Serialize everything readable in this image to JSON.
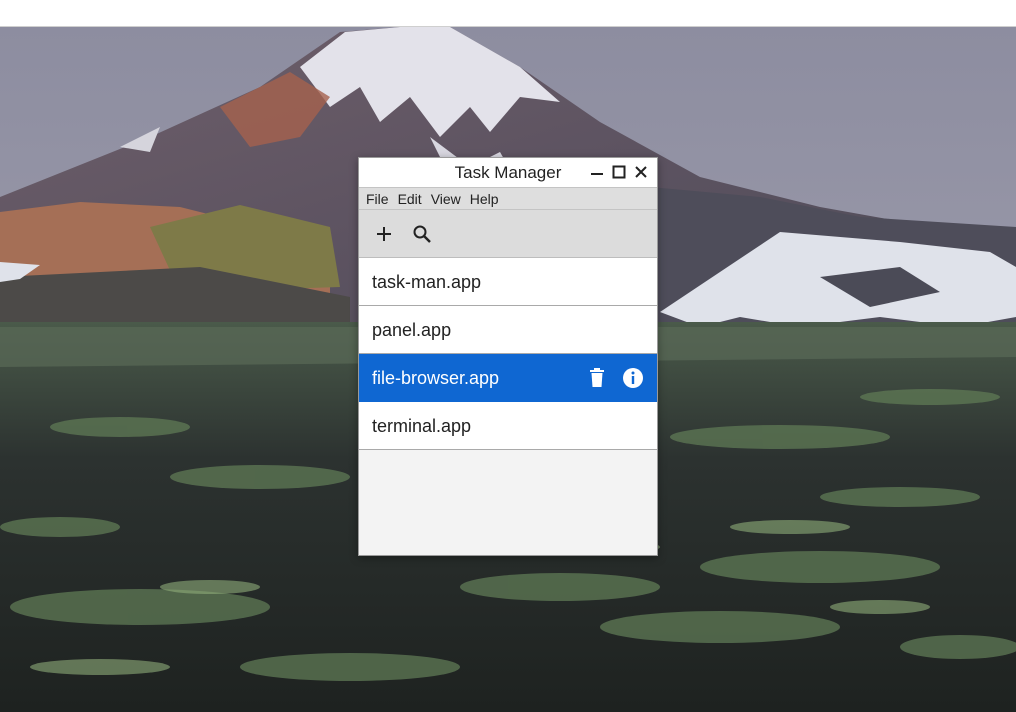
{
  "window": {
    "title": "Task Manager",
    "controls": {
      "minimize_icon": "minimize-icon",
      "maximize_icon": "maximize-icon",
      "close_icon": "close-icon"
    }
  },
  "menubar": {
    "items": [
      {
        "label": "File"
      },
      {
        "label": "Edit"
      },
      {
        "label": "View"
      },
      {
        "label": "Help"
      }
    ]
  },
  "toolbar": {
    "add_icon": "plus-icon",
    "search_icon": "search-icon"
  },
  "list": {
    "items": [
      {
        "label": "task-man.app",
        "selected": false
      },
      {
        "label": "panel.app",
        "selected": false
      },
      {
        "label": "file-browser.app",
        "selected": true,
        "actions": [
          "trash-icon",
          "info-icon"
        ]
      },
      {
        "label": "terminal.app",
        "selected": false
      }
    ]
  },
  "colors": {
    "selection": "#0f67d2",
    "menubar": "#dedede",
    "toolbar": "#dcdcdc",
    "window_background": "#f3f3f3"
  }
}
